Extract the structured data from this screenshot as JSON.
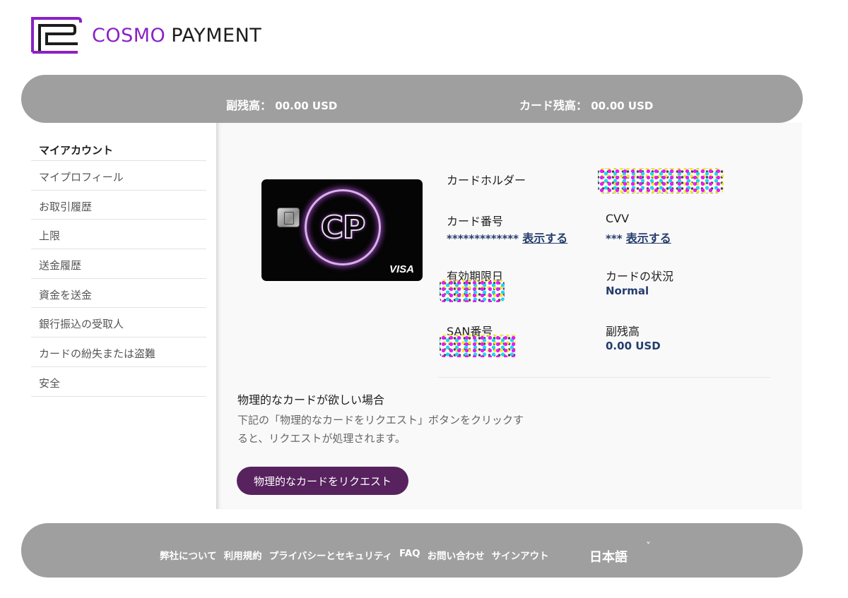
{
  "brand": {
    "name_part1": "COSMO",
    "name_part2": "PAYMENT",
    "accent_color": "#8a22c4"
  },
  "balances": {
    "sub_balance_label": "副残高：",
    "sub_balance_value": "00.00 USD",
    "card_balance_label": "カード残高：",
    "card_balance_value": "00.00 USD"
  },
  "sidebar": {
    "heading": "マイアカウント",
    "items": [
      {
        "label": "マイプロフィール"
      },
      {
        "label": "お取引履歴"
      },
      {
        "label": "上限"
      },
      {
        "label": "送金履歴"
      },
      {
        "label": "資金を送金"
      },
      {
        "label": "銀行振込の受取人"
      },
      {
        "label": "カードの紛失または盗難"
      },
      {
        "label": "安全"
      }
    ]
  },
  "card": {
    "logo_text": "CP",
    "network": "VISA",
    "chip_icon": "chip-icon"
  },
  "card_info": {
    "holder_label": "カードホルダー",
    "number_label": "カード番号",
    "number_masked": "*************",
    "show_label": "表示する",
    "cvv_label": "CVV",
    "cvv_masked": "***",
    "expiry_label": "有効期限日",
    "status_label": "カードの状況",
    "status_value": "Normal",
    "san_label": "SAN番号",
    "sub_balance_label": "副残高",
    "sub_balance_value": "0.00 USD"
  },
  "physical_card": {
    "title": "物理的なカードが欲しい場合",
    "description": "下記の「物理的なカードをリクエスト」ボタンをクリックすると、リクエストが処理されます。",
    "button_label": "物理的なカードをリクエスト",
    "button_color": "#57225e"
  },
  "footer": {
    "links": [
      {
        "label": "弊社について"
      },
      {
        "label": "利用規約"
      },
      {
        "label": "プライバシーとセキュリティ"
      },
      {
        "label": "FAQ"
      },
      {
        "label": "お問い合わせ"
      },
      {
        "label": "サインアウト"
      }
    ],
    "language": "日本語",
    "language_icon": "chevron-down-icon"
  }
}
